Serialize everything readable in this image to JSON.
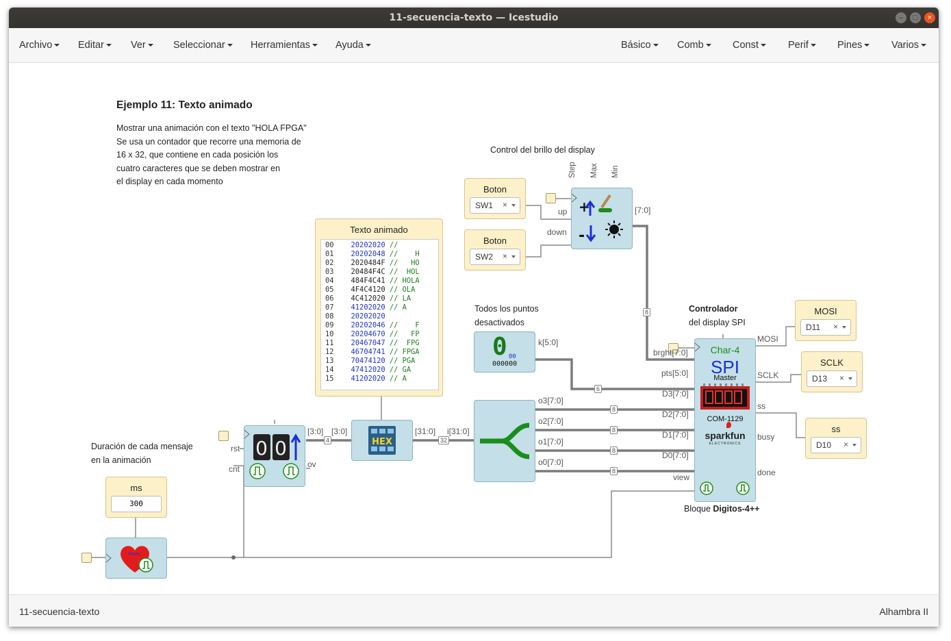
{
  "window": {
    "title": "11-secuencia-texto — Icestudio"
  },
  "menu_left": [
    "Archivo",
    "Editar",
    "Ver",
    "Seleccionar",
    "Herramientas",
    "Ayuda"
  ],
  "menu_right": [
    "Básico",
    "Comb",
    "Const",
    "Perif",
    "Pines",
    "Varios"
  ],
  "status": {
    "project": "11-secuencia-texto",
    "board": "Alhambra II"
  },
  "notes": {
    "heading": "Ejemplo 11: Texto animado",
    "description": "Mostrar una animación con el texto \"HOLA FPGA\"\nSe usa un contador que recorre una memoria de\n16 x 32, que contiene en cada posición los\ncuatro caracteres que se deben mostrar en\nel display en cada momento",
    "brillo": "Control del brillo del display",
    "puntos": "Todos los puntos\ndesactivados",
    "duracion": "Duración de cada mensaje\nen la animación",
    "controlador": "Controlador",
    "controlador2": "del display SPI",
    "bloque_prefix": "Bloque ",
    "bloque_name": "Digitos-4++"
  },
  "inputs": {
    "sw1": {
      "label": "Boton",
      "value": "SW1"
    },
    "sw2": {
      "label": "Boton",
      "value": "SW2"
    },
    "mosi": {
      "label": "MOSI",
      "value": "D11"
    },
    "sclk": {
      "label": "SCLK",
      "value": "D13"
    },
    "ss": {
      "label": "ss",
      "value": "D10"
    },
    "ms": {
      "label": "ms",
      "value": "300"
    }
  },
  "memory": {
    "title": "Texto animado",
    "rows": [
      {
        "addr": "00",
        "hex": "20202020",
        "comment": "//"
      },
      {
        "addr": "01",
        "hex": "20202048",
        "comment": "//    H"
      },
      {
        "addr": "02",
        "hex": "2020484F",
        "comment": "//   HO"
      },
      {
        "addr": "03",
        "hex": "20484F4C",
        "comment": "//  HOL"
      },
      {
        "addr": "04",
        "hex": "484F4C41",
        "comment": "// HOLA"
      },
      {
        "addr": "05",
        "hex": "4F4C4120",
        "comment": "// OLA"
      },
      {
        "addr": "06",
        "hex": "4C412020",
        "comment": "// LA"
      },
      {
        "addr": "07",
        "hex": "41202020",
        "comment": "// A"
      },
      {
        "addr": "08",
        "hex": "20202020",
        "comment": ""
      },
      {
        "addr": "09",
        "hex": "20202046",
        "comment": "//    F"
      },
      {
        "addr": "10",
        "hex": "20204670",
        "comment": "//   FP"
      },
      {
        "addr": "11",
        "hex": "20467047",
        "comment": "//  FPG"
      },
      {
        "addr": "12",
        "hex": "46704741",
        "comment": "// FPGA"
      },
      {
        "addr": "13",
        "hex": "70474120",
        "comment": "// PGA"
      },
      {
        "addr": "14",
        "hex": "47412020",
        "comment": "// GA"
      },
      {
        "addr": "15",
        "hex": "41202020",
        "comment": "// A"
      }
    ]
  },
  "ports": {
    "up": "up",
    "down": "down",
    "step": "Step",
    "max": "Max",
    "min": "Min",
    "brillo_out": "[7:0]",
    "rst": "rst",
    "cnt": "cnt",
    "ov": "ov",
    "cnt_out": "[3:0]",
    "hex_in": "[3:0]",
    "hex_out": "[31:0]",
    "split_in": "i[31:0]",
    "o3": "o3[7:0]",
    "o2": "o2[7:0]",
    "o1": "o1[7:0]",
    "o0": "o0[7:0]",
    "k": "k[5:0]",
    "brght": "brght[7:0]",
    "pts": "pts[5:0]",
    "d3": "D3[7:0]",
    "d2": "D2[7:0]",
    "d1": "D1[7:0]",
    "d0": "D0[7:0]",
    "view": "view",
    "mosi": "MOSI",
    "sclk": "SCLK",
    "ss": "ss",
    "busy": "busy",
    "done": "done"
  },
  "wire_sizes": {
    "brillo": "8",
    "pts": "6",
    "d3": "8",
    "d2": "8",
    "d1": "8",
    "d0": "8",
    "cnt": "4",
    "hex": "32"
  },
  "constant": {
    "digit": "0",
    "sub": "00",
    "bits": "000000"
  },
  "spi_block": {
    "title": "Char-4",
    "spi": "SPI",
    "master": "Master",
    "part": "COM-1129",
    "brand": "sparkfun",
    "brand_sub": "ELECTRONICS"
  },
  "timer_icon": "heart-timer-icon",
  "colors": {
    "block": "#c4dfe8",
    "input": "#fdf1c9",
    "wire": "#777777",
    "accent": "#e95420"
  }
}
